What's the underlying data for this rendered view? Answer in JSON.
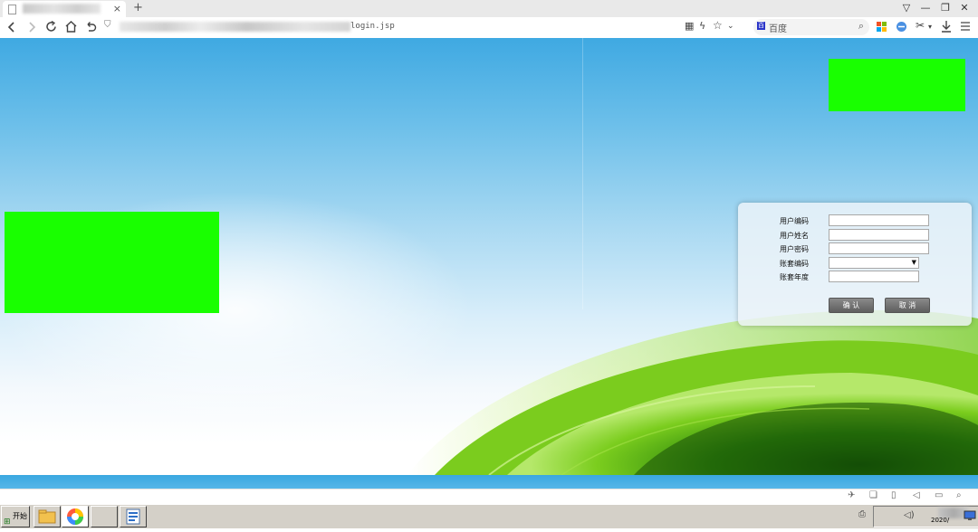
{
  "browser": {
    "tab_close": "×",
    "new_tab": "+",
    "address_tail": "login.jsp",
    "search_badge": "百",
    "search_placeholder": "百度",
    "window_controls": [
      "▽",
      "—",
      "❐",
      "✕"
    ],
    "nav_icons": [
      "back-icon",
      "forward-icon",
      "refresh-icon",
      "home-icon",
      "undo-icon"
    ],
    "toolbar_icons": [
      "qr-icon",
      "lightning-icon",
      "star-icon",
      "dropdown-icon",
      "microsoft-icon",
      "extension-icon",
      "scissors-icon",
      "download-icon",
      "menu-icon"
    ]
  },
  "login": {
    "user_code_label": "用户编码",
    "user_name_label": "用户姓名",
    "password_label": "用户密码",
    "account_code_label": "账套编码",
    "account_year_label": "账套年度",
    "user_code_value": "",
    "user_name_value": "",
    "password_value": "",
    "account_code_value": "",
    "account_year_value": "",
    "confirm_label": "确 认",
    "cancel_label": "取 消"
  },
  "taskbar": {
    "start_label": "开始",
    "clock_text": "2020/"
  },
  "colors": {
    "redaction": "#19ff00",
    "sky_top": "#3fa9e2",
    "grass": "#6cc218"
  }
}
